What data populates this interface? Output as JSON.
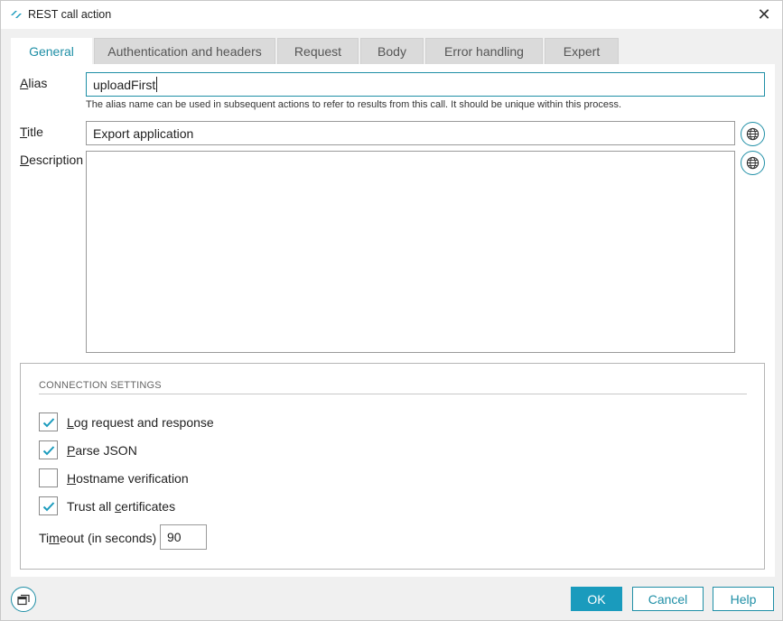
{
  "window": {
    "title": "REST call action",
    "close_label": "✕"
  },
  "tabs": [
    {
      "label": "General",
      "active": true
    },
    {
      "label": "Authentication and headers",
      "active": false
    },
    {
      "label": "Request",
      "active": false
    },
    {
      "label": "Body",
      "active": false
    },
    {
      "label": "Error handling",
      "active": false
    },
    {
      "label": "Expert",
      "active": false
    }
  ],
  "general": {
    "alias": {
      "label_accel": "A",
      "label_rest": "lias",
      "value": "uploadFirst",
      "hint": "The alias name can be used in subsequent actions to refer to results from this call. It should be unique within this process."
    },
    "title": {
      "label_accel": "T",
      "label_rest": "itle",
      "value": "Export application"
    },
    "description": {
      "label_accel": "D",
      "label_rest": "escription",
      "value": ""
    }
  },
  "connection_settings": {
    "heading": "CONNECTION SETTINGS",
    "options": [
      {
        "pre": "",
        "accel": "L",
        "post": "og request and response",
        "checked": true
      },
      {
        "pre": "",
        "accel": "P",
        "post": "arse JSON",
        "checked": true
      },
      {
        "pre": "",
        "accel": "H",
        "post": "ostname verification",
        "checked": false
      },
      {
        "pre": "Trust all ",
        "accel": "c",
        "post": "ertificates",
        "checked": true
      }
    ],
    "timeout": {
      "pre": "Ti",
      "accel": "m",
      "post": "eout (in seconds)",
      "value": "90"
    }
  },
  "buttons": {
    "ok": "OK",
    "cancel": "Cancel",
    "help": "Help"
  },
  "colors": {
    "accent": "#1a9bbd",
    "accent_text": "#1f8fa6",
    "tab_inactive": "#dadada"
  },
  "icons": {
    "app": "rest-action-icon",
    "translate": "globe-icon",
    "restore": "window-restore-icon",
    "check": "checkmark-icon"
  }
}
